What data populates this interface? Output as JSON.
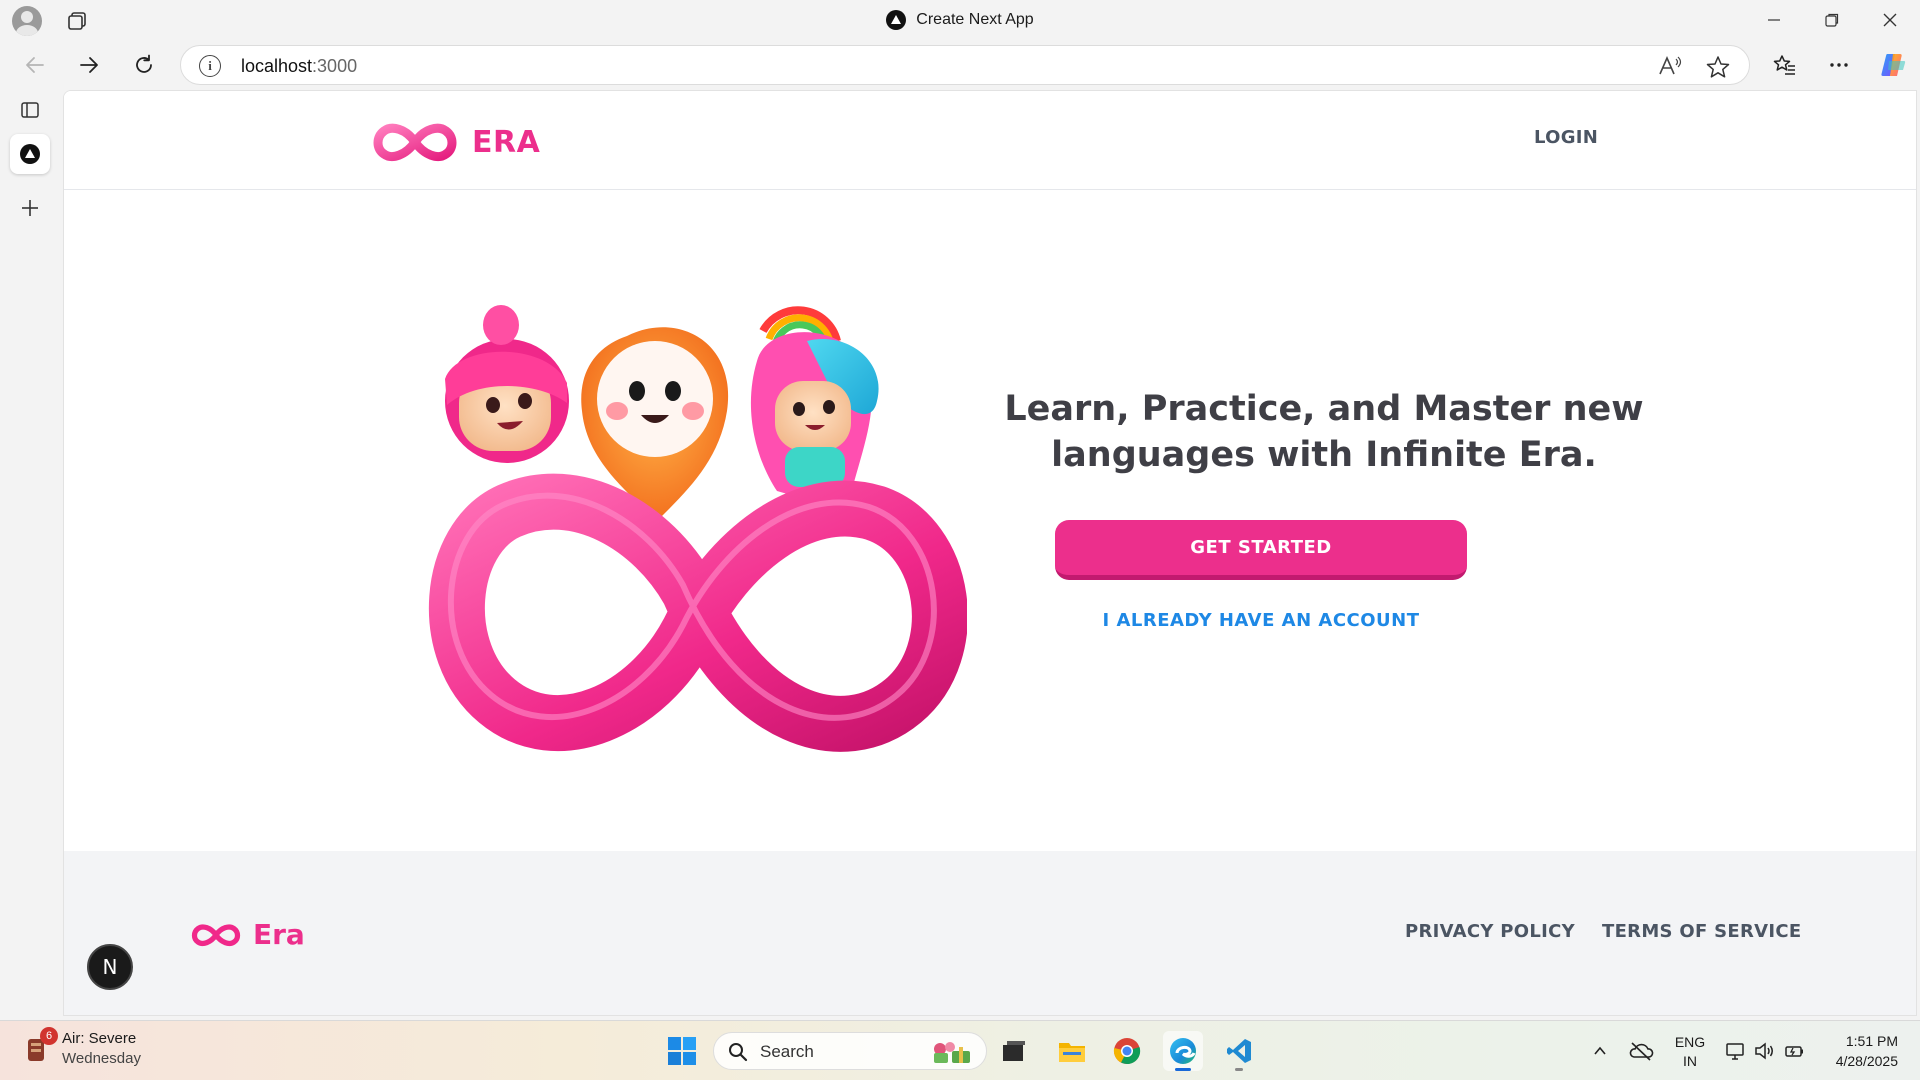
{
  "browser": {
    "window_title": "Create Next App",
    "url_host": "localhost",
    "url_port": ":3000"
  },
  "site": {
    "brand_name": "ERA",
    "nav": {
      "login_label": "LOGIN"
    },
    "hero": {
      "heading_line1": "Learn, Practice, and Master new",
      "heading_line2": "languages with Infinite Era.",
      "primary_cta": "GET STARTED",
      "secondary_cta": "I ALREADY HAVE AN ACCOUNT"
    },
    "footer": {
      "brand_name": "Era",
      "privacy_label": "PRIVACY POLICY",
      "terms_label": "TERMS OF SERVICE"
    },
    "dev_badge": "N",
    "colors": {
      "brand_pink": "#ec2f8c",
      "link_blue": "#1e88e5",
      "text_gray": "#4b5563"
    }
  },
  "taskbar": {
    "weather_badge": "6",
    "weather_title": "Air: Severe",
    "weather_subtitle": "Wednesday",
    "search_label": "Search",
    "language_line1": "ENG",
    "language_line2": "IN",
    "time": "1:51 PM",
    "date": "4/28/2025"
  }
}
